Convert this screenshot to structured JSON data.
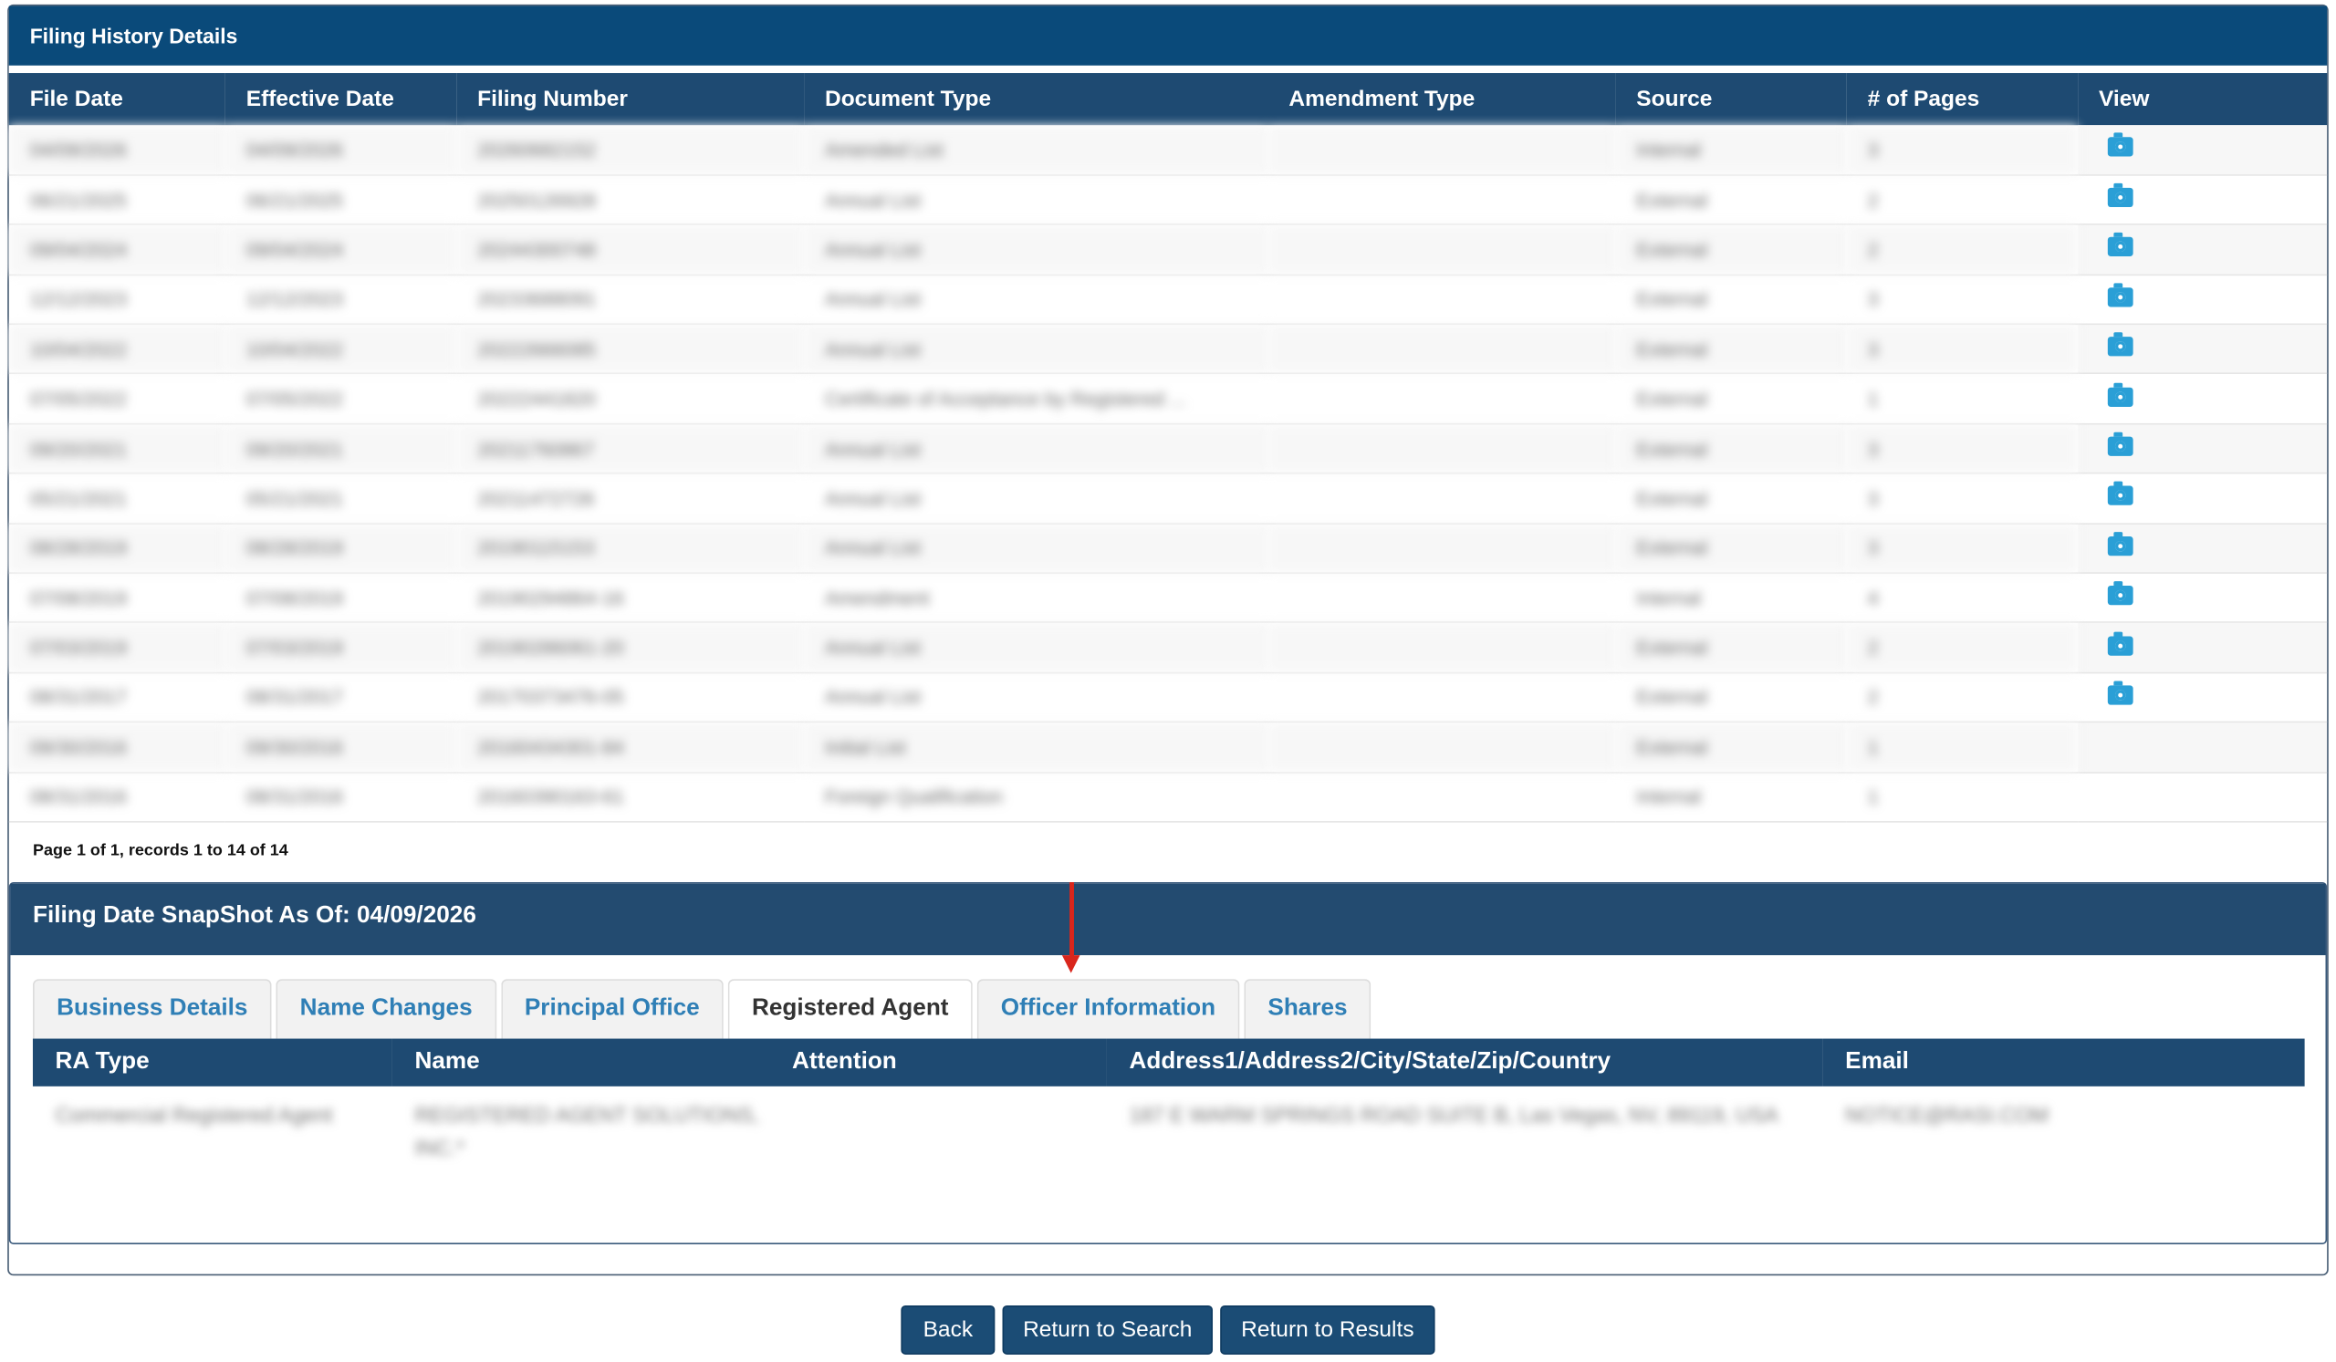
{
  "history": {
    "title": "Filing History Details",
    "columns": [
      "File Date",
      "Effective Date",
      "Filing Number",
      "Document Type",
      "Amendment Type",
      "Source",
      "# of Pages",
      "View"
    ],
    "rows": [
      [
        "04/09/2026",
        "04/09/2026",
        "20260682152",
        "Amended List",
        "",
        "Internal",
        "3",
        "camera-icon"
      ],
      [
        "06/21/2025",
        "06/21/2025",
        "20250126928",
        "Annual List",
        "",
        "External",
        "2",
        "camera-icon"
      ],
      [
        "09/04/2024",
        "09/04/2024",
        "20244300748",
        "Annual List",
        "",
        "External",
        "2",
        "camera-icon"
      ],
      [
        "12/12/2023",
        "12/12/2023",
        "20233688091",
        "Annual List",
        "",
        "External",
        "3",
        "camera-icon"
      ],
      [
        "10/04/2022",
        "10/04/2022",
        "20222666085",
        "Annual List",
        "",
        "External",
        "3",
        "camera-icon"
      ],
      [
        "07/05/2022",
        "07/05/2022",
        "20222441820",
        "Certificate of Acceptance by Registered ...",
        "",
        "External",
        "1",
        "camera-icon"
      ],
      [
        "09/20/2021",
        "09/20/2021",
        "20211760867",
        "Annual List",
        "",
        "External",
        "3",
        "camera-icon"
      ],
      [
        "05/21/2021",
        "05/21/2021",
        "20211472726",
        "Annual List",
        "",
        "External",
        "3",
        "camera-icon"
      ],
      [
        "08/28/2019",
        "08/28/2019",
        "20190115153",
        "Annual List",
        "",
        "External",
        "3",
        "camera-icon"
      ],
      [
        "07/08/2019",
        "07/08/2019",
        "20190294864-16",
        "Amendment",
        "",
        "Internal",
        "4",
        "camera-icon"
      ],
      [
        "07/03/2019",
        "07/03/2019",
        "20190286061-20",
        "Annual List",
        "",
        "External",
        "2",
        "camera-icon"
      ],
      [
        "08/31/2017",
        "08/31/2017",
        "20170373476-05",
        "Annual List",
        "",
        "External",
        "2",
        "camera-icon"
      ],
      [
        "09/30/2016",
        "09/30/2016",
        "20160434301-84",
        "Initial List",
        "",
        "External",
        "1",
        ""
      ],
      [
        "08/31/2016",
        "08/31/2016",
        "20160390163-61",
        "Foreign Qualification",
        "",
        "Internal",
        "1",
        ""
      ]
    ],
    "pager": "Page 1 of 1, records 1 to 14 of 14"
  },
  "snapshot": {
    "title": "Filing Date SnapShot As Of: 04/09/2026",
    "tabs": [
      "Business Details",
      "Name Changes",
      "Principal Office",
      "Registered Agent",
      "Officer Information",
      "Shares"
    ],
    "active_tab": "Registered Agent",
    "ra_table": {
      "columns": [
        "RA Type",
        "Name",
        "Attention",
        "Address1/Address2/City/State/Zip/Country",
        "Email"
      ],
      "row": [
        "Commercial Registered Agent",
        "REGISTERED AGENT SOLUTIONS, INC.*",
        "",
        "187 E WARM SPRINGS ROAD SUITE B, Las Vegas, NV, 89119, USA",
        "NOTICE@RASI.COM"
      ]
    }
  },
  "buttons": {
    "back": "Back",
    "return_search": "Return to Search",
    "return_results": "Return to Results"
  },
  "colors": {
    "header_blue": "#1e4a72",
    "title_blue": "#0a4a7a",
    "link_blue": "#2f7fb6",
    "icon_blue": "#2a9fd6",
    "annotation_red": "#d9261c"
  }
}
